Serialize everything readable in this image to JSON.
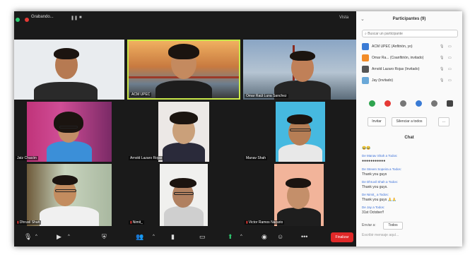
{
  "topbar": {
    "recording_label": "Grabando...",
    "pause": "❚❚",
    "stop": "■",
    "view_label": "Vista"
  },
  "tiles": [
    {
      "name": "",
      "bg": "#e9ecef"
    },
    {
      "name": "ACM UPEC",
      "bg": "#d08a45"
    },
    {
      "name": "Omar Raúl Luna Sanchez",
      "bg": "#8aa5c4"
    },
    {
      "name": "Jatz Chacón",
      "bg": "#b83a8a"
    },
    {
      "name": "Arnold Lazaro Rojas",
      "bg": "#ece8e6"
    },
    {
      "name": "Manav Shah",
      "bg": "#46b9e0"
    },
    {
      "name": "Dhruvil Shah",
      "bg": "#c8d4be"
    },
    {
      "name": "Nimit_",
      "bg": "#f0f0ee"
    },
    {
      "name": "Victor Ramos Nacario",
      "bg": "#f2b49a"
    }
  ],
  "toolbar": {
    "end_label": "Finalizar"
  },
  "side": {
    "title": "Participantes (9)",
    "search_placeholder": "Buscar un participante",
    "participants": [
      {
        "name": "ACM UPEC (Anfitrión, yo)",
        "color": "#3a7bd5"
      },
      {
        "name": "Omar Ra... (Coanfitrión, invitado)",
        "color": "#f28c28"
      },
      {
        "name": "Arnold Lazaro Rojas (Invitado)",
        "color": "#555555"
      },
      {
        "name": "Jay (Invitado)",
        "color": "#6aa8d8"
      }
    ],
    "invite_label": "Invitar",
    "mute_all_label": "Silenciar a todos",
    "more_label": "...",
    "chat_title": "Chat"
  },
  "chat": {
    "messages": [
      {
        "from": "",
        "text": "😂😂"
      },
      {
        "from": "De Manav Shah a Todos:",
        "text": "●●●●●●●●●●●"
      },
      {
        "from": "De Steven Sopeira a Todos:",
        "text": "Thank you guys"
      },
      {
        "from": "De Dhruvil Shah a Todos:",
        "text": "Thank you guys."
      },
      {
        "from": "De Nimit_ a Todos:",
        "text": "Thank you guys 🙏🙏"
      },
      {
        "from": "De Jay a Todos:",
        "text": "31st October!!"
      }
    ],
    "send_to_label": "Enviar a:",
    "send_to_value": "Todos",
    "input_placeholder": "Escribir mensaje aquí..."
  }
}
